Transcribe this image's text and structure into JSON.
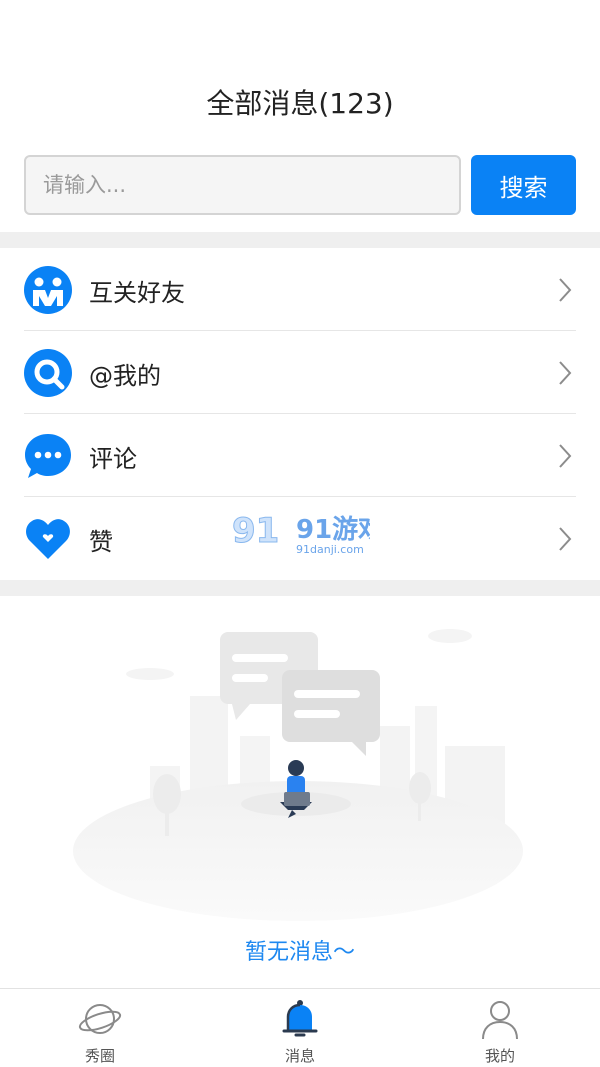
{
  "header": {
    "title": "全部消息(123)"
  },
  "search": {
    "placeholder": "请输入...",
    "button_label": "搜索"
  },
  "menu": {
    "items": [
      {
        "label": "互关好友",
        "icon": "mutual-friends-icon"
      },
      {
        "label": "@我的",
        "icon": "at-mention-icon"
      },
      {
        "label": "评论",
        "icon": "comment-icon"
      },
      {
        "label": "赞",
        "icon": "heart-icon"
      }
    ]
  },
  "empty_state": {
    "text": "暂无消息～"
  },
  "watermark": {
    "brand": "91游戏",
    "site": "91danji.com"
  },
  "tabbar": {
    "tabs": [
      {
        "label": "秀圈",
        "icon": "planet-icon",
        "active": false
      },
      {
        "label": "消息",
        "icon": "bell-icon",
        "active": true
      },
      {
        "label": "我的",
        "icon": "user-icon",
        "active": false
      }
    ]
  },
  "colors": {
    "accent": "#0A82F5",
    "divider": "#EFEFEF",
    "text": "#222222"
  }
}
